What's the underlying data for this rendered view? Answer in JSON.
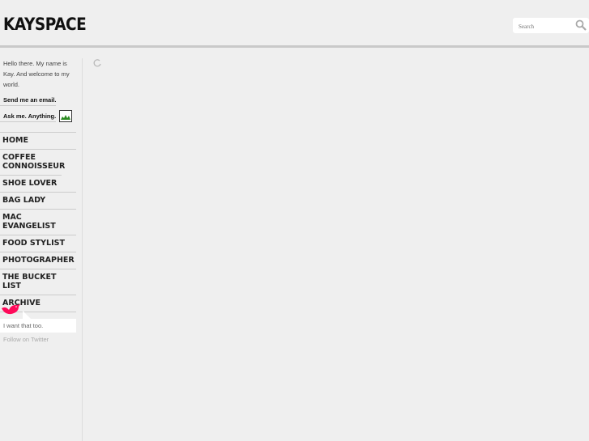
{
  "header": {
    "logo": "KAYSPACE",
    "search_placeholder": "Search"
  },
  "sidebar": {
    "intro": "Hello there. My name is Kay. And welcome to my world.",
    "email_link": "Send me an email.",
    "ask_link": "Ask me. Anything.",
    "nav": [
      "HOME",
      "COFFEE CONNOISSEUR",
      "SHOE LOVER",
      "BAG LADY",
      "MAC EVANGELIST",
      "FOOD STYLIST",
      "PHOTOGRAPHER",
      "THE BUCKET LIST",
      "ARCHIVE"
    ],
    "tweet": "I want that too.",
    "follow": "Follow on Twitter"
  },
  "colors": {
    "twitter_bird": "#ff0a5a"
  }
}
